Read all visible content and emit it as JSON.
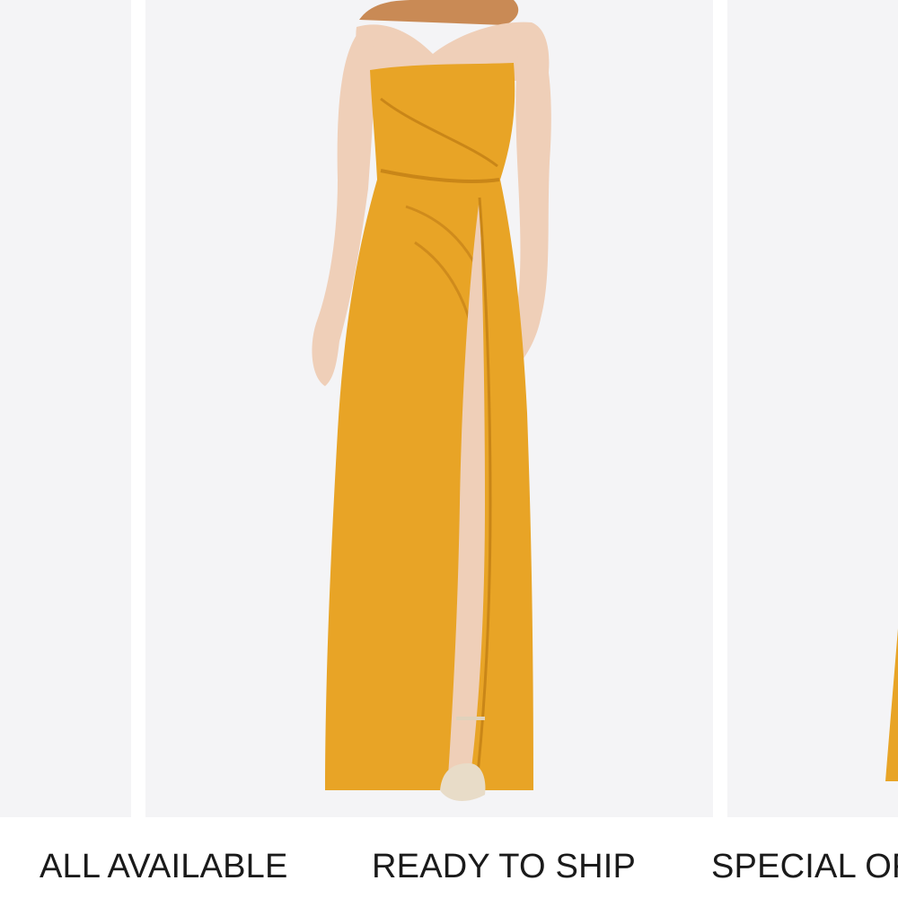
{
  "colors": {
    "panel_background": "#f4f4f6",
    "dress": "#e8a426",
    "skin": "#efcfb8",
    "text": "#1a1a1a"
  },
  "images": {
    "left": {
      "icon": "product-image-partial"
    },
    "center": {
      "icon": "product-photo-strapless-gown-with-slit"
    },
    "right": {
      "icon": "product-image-partial"
    }
  },
  "tabs": [
    {
      "label": "ALL AVAILABLE"
    },
    {
      "label": "READY TO SHIP"
    },
    {
      "label": "SPECIAL OFFERS"
    }
  ]
}
